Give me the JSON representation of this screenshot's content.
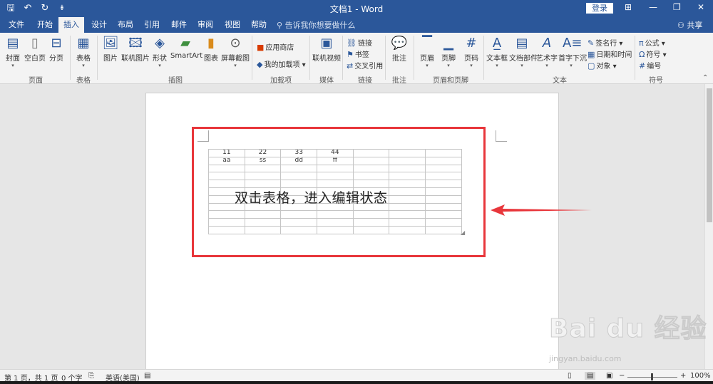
{
  "titlebar": {
    "title": "文档1 - Word",
    "login": "登录",
    "quick_access": {
      "save_icon": "🖫",
      "undo_icon": "↶",
      "redo_icon": "↻",
      "customize_icon": "⇟"
    },
    "controls": {
      "ribbon_display_icon": "⊞",
      "minimize_icon": "—",
      "restore_icon": "❐",
      "close_icon": "✕"
    }
  },
  "tabs": [
    "文件",
    "开始",
    "插入",
    "设计",
    "布局",
    "引用",
    "邮件",
    "审阅",
    "视图",
    "帮助"
  ],
  "active_tab": "插入",
  "tell_me": "告诉我你想要做什么",
  "share": "共享",
  "ribbon": {
    "pages": {
      "cover": "封面",
      "blank": "空白页",
      "break": "分页",
      "group": "页面"
    },
    "tables": {
      "table": "表格",
      "group": "表格"
    },
    "illustrations": {
      "picture": "图片",
      "online_picture": "联机图片",
      "shapes": "形状",
      "smartart": "SmartArt",
      "chart": "图表",
      "screenshot": "屏幕截图",
      "group": "插图"
    },
    "addins": {
      "store": "应用商店",
      "my_addins": "我的加载项",
      "group": "加载项"
    },
    "media": {
      "online_video": "联机视频",
      "group": "媒体"
    },
    "links": {
      "link": "链接",
      "bookmark": "书签",
      "cross_ref": "交叉引用",
      "group": "链接"
    },
    "comments": {
      "comment": "批注",
      "group": "批注"
    },
    "header_footer": {
      "header": "页眉",
      "footer": "页脚",
      "page_number": "页码",
      "group": "页眉和页脚"
    },
    "text": {
      "textbox": "文本框",
      "quick_parts": "文档部件",
      "wordart": "艺术字",
      "dropcap": "首字下沉",
      "signature": "签名行",
      "datetime": "日期和时间",
      "object": "对象",
      "group": "文本"
    },
    "symbols": {
      "equation": "公式",
      "symbol": "符号",
      "number": "编号",
      "group": "符号"
    }
  },
  "document": {
    "table_rows": [
      [
        "11",
        "22",
        "33",
        "44",
        "",
        "",
        ""
      ],
      [
        "aa",
        "ss",
        "dd",
        "ff",
        "",
        "",
        ""
      ],
      [
        "",
        "",
        "",
        "",
        "",
        "",
        ""
      ],
      [
        "",
        "",
        "",
        "",
        "",
        "",
        ""
      ],
      [
        "",
        "",
        "",
        "",
        "",
        "",
        ""
      ],
      [
        "",
        "",
        "",
        "",
        "",
        "",
        ""
      ],
      [
        "",
        "",
        "",
        "",
        "",
        "",
        ""
      ],
      [
        "",
        "",
        "",
        "",
        "",
        "",
        ""
      ],
      [
        "",
        "",
        "",
        "",
        "",
        "",
        ""
      ],
      [
        "",
        "",
        "",
        "",
        "",
        "",
        ""
      ],
      [
        "",
        "",
        "",
        "",
        "",
        "",
        ""
      ]
    ],
    "annotation": "双击表格，进入编辑状态"
  },
  "watermark": {
    "logo": "Bai du 经验",
    "url": "jingyan.baidu.com"
  },
  "statusbar": {
    "page": "第 1 页，共 1 页",
    "words": "0 个字",
    "language": "英语(美国)",
    "zoom": "100%",
    "zoom_level": 1.0
  },
  "colors": {
    "brand": "#2b579a",
    "highlight": "#e8363b"
  }
}
